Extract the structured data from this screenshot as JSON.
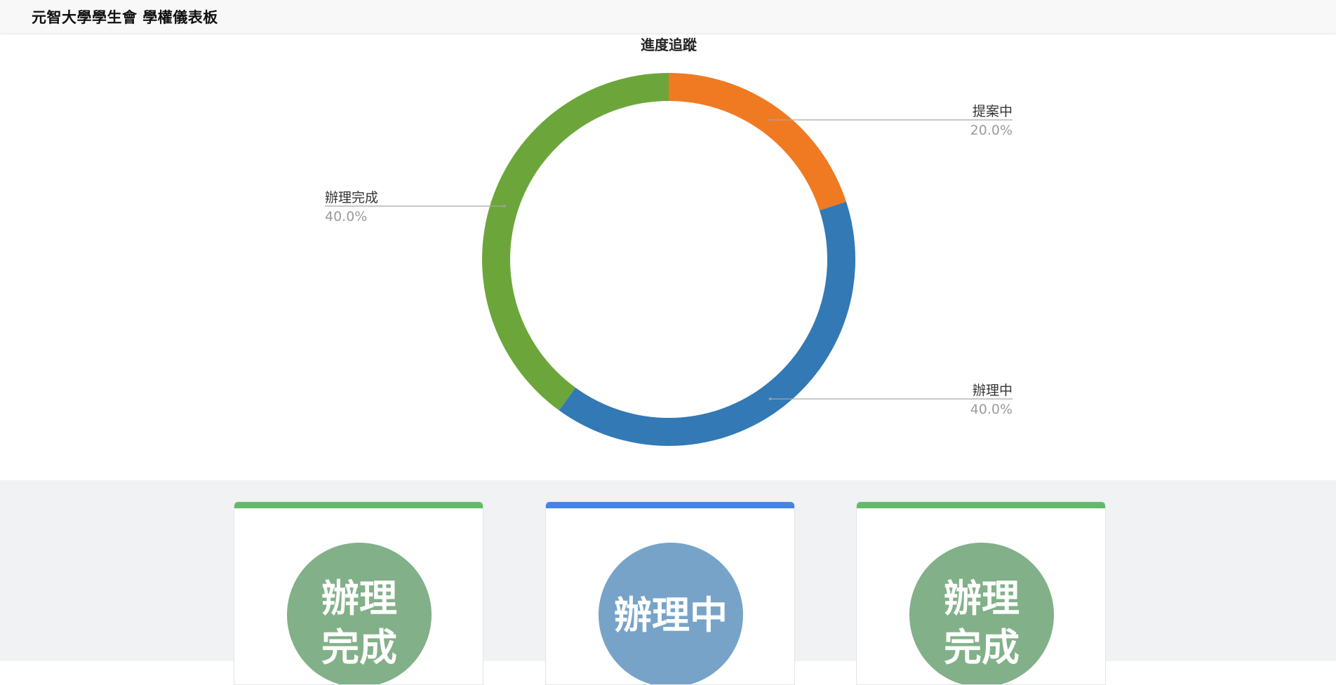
{
  "app": {
    "title": "元智大學學生會 學權儀表板"
  },
  "chart_data": {
    "type": "pie",
    "title": "進度追蹤",
    "donut": true,
    "unit": "%",
    "categories": [
      "提案中",
      "辦理中",
      "辦理完成"
    ],
    "values": [
      20.0,
      40.0,
      40.0
    ],
    "labels": [
      "20.0%",
      "40.0%",
      "40.0%"
    ],
    "colors": [
      "#f07a22",
      "#3279b5",
      "#6ca63b"
    ],
    "start_angle_deg": 0,
    "direction": "clockwise"
  },
  "cards": [
    {
      "status": "辦理完成",
      "bar_color": "#63bb6a",
      "badge_color": "#82b088"
    },
    {
      "status": "辦理中",
      "bar_color": "#4584e2",
      "badge_color": "#77a3c9"
    },
    {
      "status": "辦理完成",
      "bar_color": "#63bb6a",
      "badge_color": "#82b088"
    }
  ]
}
